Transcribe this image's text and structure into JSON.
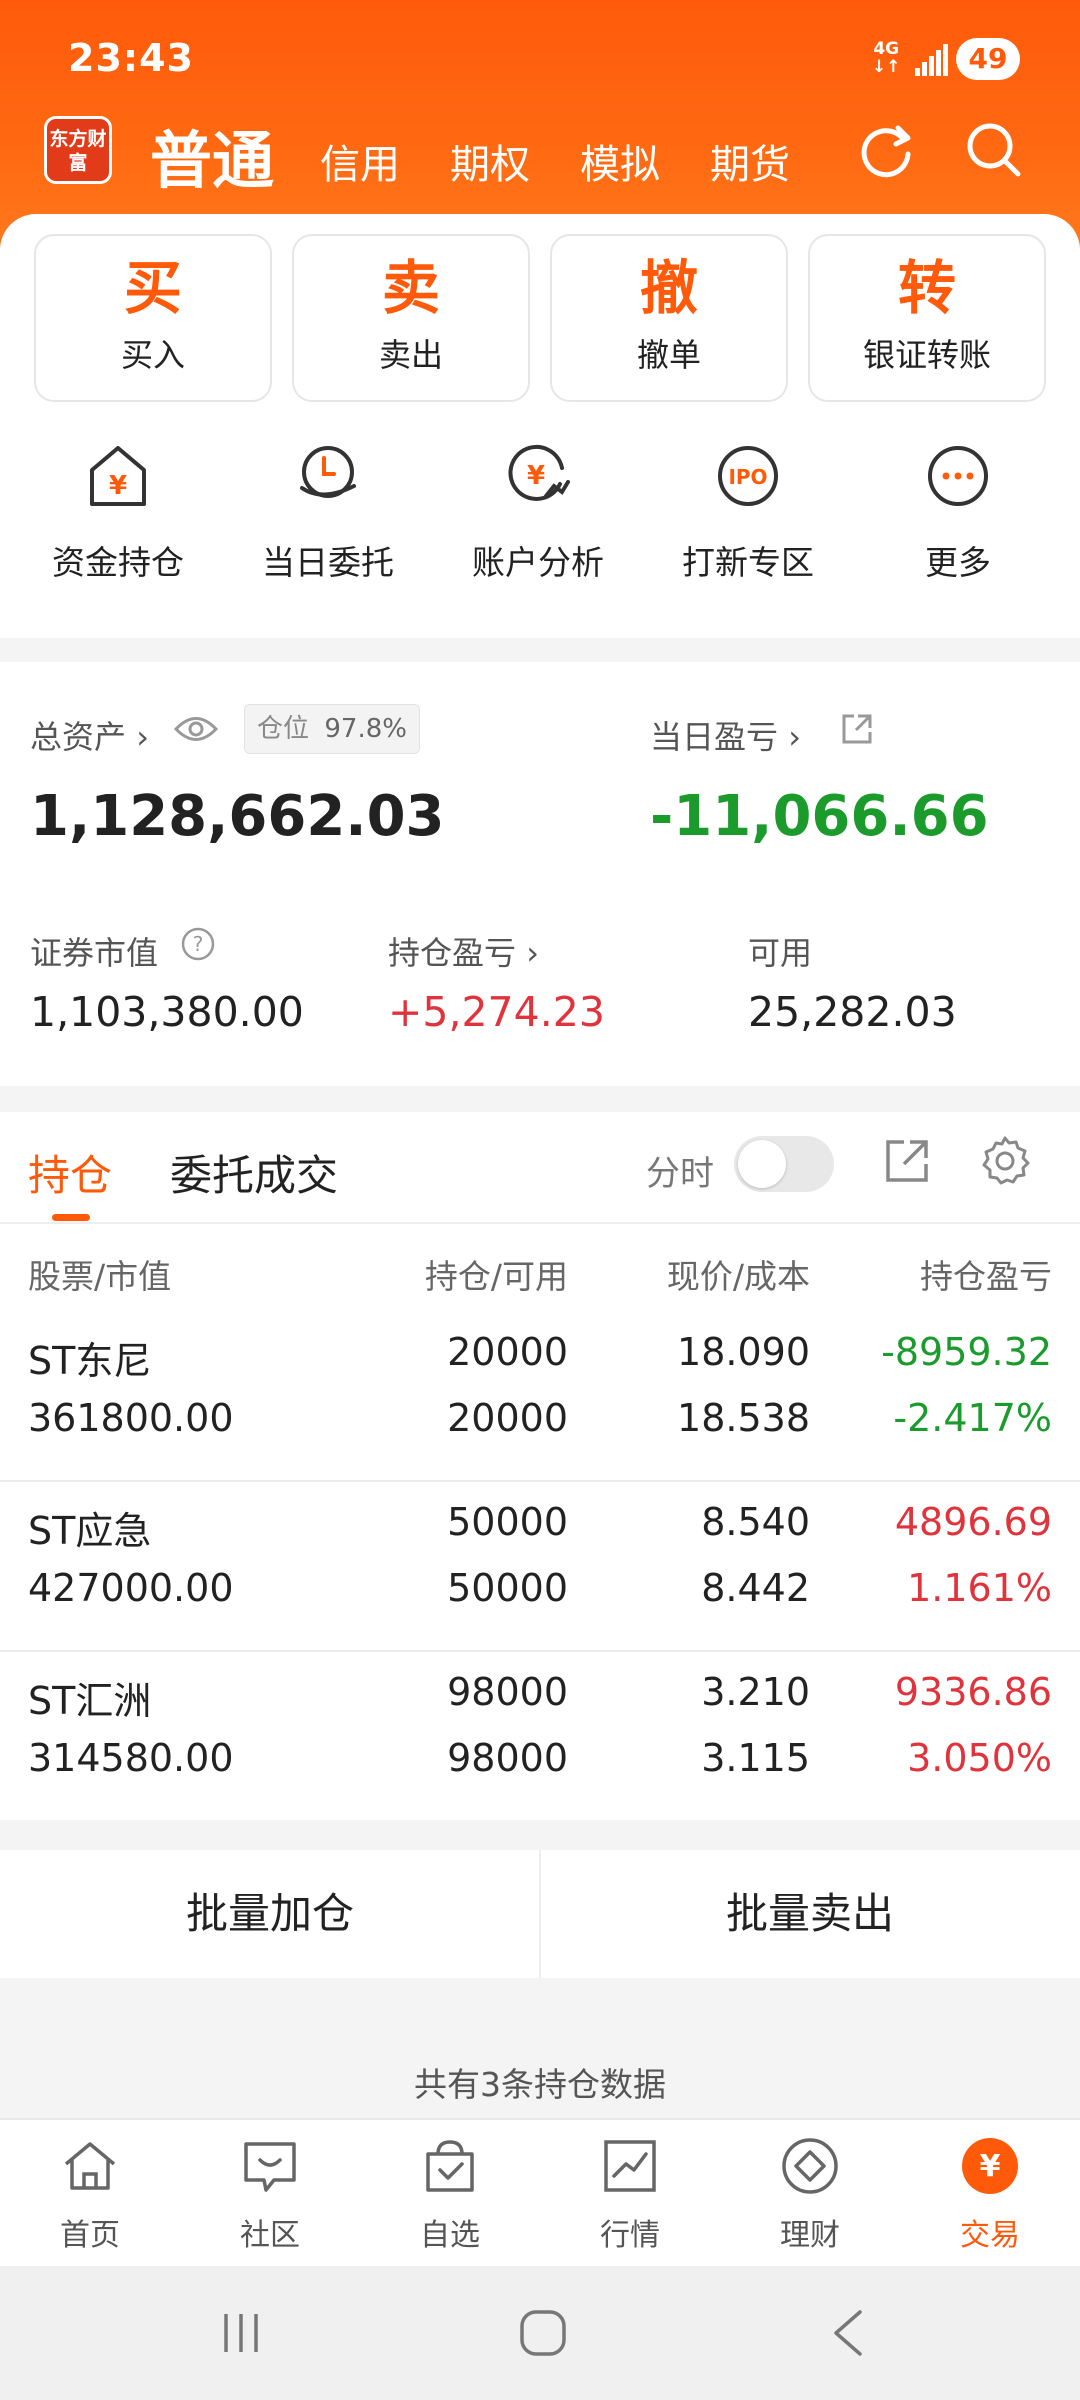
{
  "status_bar": {
    "time": "23:43",
    "network": "4G",
    "battery": "49"
  },
  "nav": {
    "logo_text": "东方财富",
    "active_tab": "普通",
    "tabs": [
      "信用",
      "期权",
      "模拟",
      "期货"
    ]
  },
  "actions": [
    {
      "glyph": "买",
      "label": "买入"
    },
    {
      "glyph": "卖",
      "label": "卖出"
    },
    {
      "glyph": "撤",
      "label": "撤单"
    },
    {
      "glyph": "转",
      "label": "银证转账"
    }
  ],
  "quick_links": [
    {
      "label": "资金持仓",
      "icon": "house-yen-icon"
    },
    {
      "label": "当日委托",
      "icon": "clock-hand-icon"
    },
    {
      "label": "账户分析",
      "icon": "yen-chart-icon"
    },
    {
      "label": "打新专区",
      "icon": "ipo-icon"
    },
    {
      "label": "更多",
      "icon": "more-icon"
    }
  ],
  "assets": {
    "total_label": "总资产",
    "position_label": "仓位",
    "position_value": "97.8%",
    "total_value": "1,128,662.03",
    "daily_pl_label": "当日盈亏",
    "daily_pl_value": "-11,066.66",
    "market_value_label": "证券市值",
    "market_value": "1,103,380.00",
    "holding_pl_label": "持仓盈亏",
    "holding_pl_value": "+5,274.23",
    "available_label": "可用",
    "available_value": "25,282.03"
  },
  "holdings": {
    "tabs": [
      "持仓",
      "委托成交"
    ],
    "toggle_label": "分时",
    "headers": [
      "股票/市值",
      "持仓/可用",
      "现价/成本",
      "持仓盈亏"
    ],
    "rows": [
      {
        "name": "ST东尼",
        "value": "361800.00",
        "pos": "20000",
        "avail": "20000",
        "price": "18.090",
        "cost": "18.538",
        "pl": "-8959.32",
        "pl_pct": "-2.417%",
        "dir": "down"
      },
      {
        "name": "ST应急",
        "value": "427000.00",
        "pos": "50000",
        "avail": "50000",
        "price": "8.540",
        "cost": "8.442",
        "pl": "4896.69",
        "pl_pct": "1.161%",
        "dir": "up"
      },
      {
        "name": "ST汇洲",
        "value": "314580.00",
        "pos": "98000",
        "avail": "98000",
        "price": "3.210",
        "cost": "3.115",
        "pl": "9336.86",
        "pl_pct": "3.050%",
        "dir": "up"
      }
    ]
  },
  "batch": {
    "add": "批量加仓",
    "sell": "批量卖出"
  },
  "total_note": "共有3条持仓数据",
  "bottom_nav": [
    {
      "label": "首页"
    },
    {
      "label": "社区"
    },
    {
      "label": "自选"
    },
    {
      "label": "行情"
    },
    {
      "label": "理财"
    },
    {
      "label": "交易",
      "active": true
    }
  ],
  "colors": {
    "brand": "#ff5a0a",
    "up": "#e0343c",
    "down": "#1a9b2c"
  }
}
